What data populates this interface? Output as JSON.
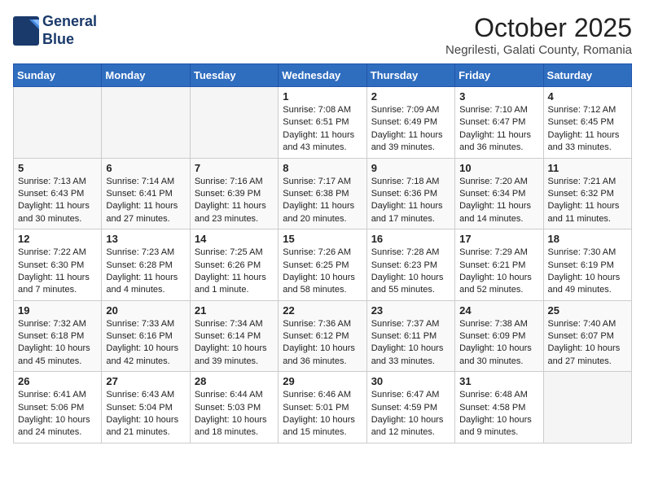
{
  "header": {
    "logo_line1": "General",
    "logo_line2": "Blue",
    "month_title": "October 2025",
    "location": "Negrilesti, Galati County, Romania"
  },
  "days_of_week": [
    "Sunday",
    "Monday",
    "Tuesday",
    "Wednesday",
    "Thursday",
    "Friday",
    "Saturday"
  ],
  "weeks": [
    [
      {
        "day": "",
        "info": ""
      },
      {
        "day": "",
        "info": ""
      },
      {
        "day": "",
        "info": ""
      },
      {
        "day": "1",
        "info": "Sunrise: 7:08 AM\nSunset: 6:51 PM\nDaylight: 11 hours\nand 43 minutes."
      },
      {
        "day": "2",
        "info": "Sunrise: 7:09 AM\nSunset: 6:49 PM\nDaylight: 11 hours\nand 39 minutes."
      },
      {
        "day": "3",
        "info": "Sunrise: 7:10 AM\nSunset: 6:47 PM\nDaylight: 11 hours\nand 36 minutes."
      },
      {
        "day": "4",
        "info": "Sunrise: 7:12 AM\nSunset: 6:45 PM\nDaylight: 11 hours\nand 33 minutes."
      }
    ],
    [
      {
        "day": "5",
        "info": "Sunrise: 7:13 AM\nSunset: 6:43 PM\nDaylight: 11 hours\nand 30 minutes."
      },
      {
        "day": "6",
        "info": "Sunrise: 7:14 AM\nSunset: 6:41 PM\nDaylight: 11 hours\nand 27 minutes."
      },
      {
        "day": "7",
        "info": "Sunrise: 7:16 AM\nSunset: 6:39 PM\nDaylight: 11 hours\nand 23 minutes."
      },
      {
        "day": "8",
        "info": "Sunrise: 7:17 AM\nSunset: 6:38 PM\nDaylight: 11 hours\nand 20 minutes."
      },
      {
        "day": "9",
        "info": "Sunrise: 7:18 AM\nSunset: 6:36 PM\nDaylight: 11 hours\nand 17 minutes."
      },
      {
        "day": "10",
        "info": "Sunrise: 7:20 AM\nSunset: 6:34 PM\nDaylight: 11 hours\nand 14 minutes."
      },
      {
        "day": "11",
        "info": "Sunrise: 7:21 AM\nSunset: 6:32 PM\nDaylight: 11 hours\nand 11 minutes."
      }
    ],
    [
      {
        "day": "12",
        "info": "Sunrise: 7:22 AM\nSunset: 6:30 PM\nDaylight: 11 hours\nand 7 minutes."
      },
      {
        "day": "13",
        "info": "Sunrise: 7:23 AM\nSunset: 6:28 PM\nDaylight: 11 hours\nand 4 minutes."
      },
      {
        "day": "14",
        "info": "Sunrise: 7:25 AM\nSunset: 6:26 PM\nDaylight: 11 hours\nand 1 minute."
      },
      {
        "day": "15",
        "info": "Sunrise: 7:26 AM\nSunset: 6:25 PM\nDaylight: 10 hours\nand 58 minutes."
      },
      {
        "day": "16",
        "info": "Sunrise: 7:28 AM\nSunset: 6:23 PM\nDaylight: 10 hours\nand 55 minutes."
      },
      {
        "day": "17",
        "info": "Sunrise: 7:29 AM\nSunset: 6:21 PM\nDaylight: 10 hours\nand 52 minutes."
      },
      {
        "day": "18",
        "info": "Sunrise: 7:30 AM\nSunset: 6:19 PM\nDaylight: 10 hours\nand 49 minutes."
      }
    ],
    [
      {
        "day": "19",
        "info": "Sunrise: 7:32 AM\nSunset: 6:18 PM\nDaylight: 10 hours\nand 45 minutes."
      },
      {
        "day": "20",
        "info": "Sunrise: 7:33 AM\nSunset: 6:16 PM\nDaylight: 10 hours\nand 42 minutes."
      },
      {
        "day": "21",
        "info": "Sunrise: 7:34 AM\nSunset: 6:14 PM\nDaylight: 10 hours\nand 39 minutes."
      },
      {
        "day": "22",
        "info": "Sunrise: 7:36 AM\nSunset: 6:12 PM\nDaylight: 10 hours\nand 36 minutes."
      },
      {
        "day": "23",
        "info": "Sunrise: 7:37 AM\nSunset: 6:11 PM\nDaylight: 10 hours\nand 33 minutes."
      },
      {
        "day": "24",
        "info": "Sunrise: 7:38 AM\nSunset: 6:09 PM\nDaylight: 10 hours\nand 30 minutes."
      },
      {
        "day": "25",
        "info": "Sunrise: 7:40 AM\nSunset: 6:07 PM\nDaylight: 10 hours\nand 27 minutes."
      }
    ],
    [
      {
        "day": "26",
        "info": "Sunrise: 6:41 AM\nSunset: 5:06 PM\nDaylight: 10 hours\nand 24 minutes."
      },
      {
        "day": "27",
        "info": "Sunrise: 6:43 AM\nSunset: 5:04 PM\nDaylight: 10 hours\nand 21 minutes."
      },
      {
        "day": "28",
        "info": "Sunrise: 6:44 AM\nSunset: 5:03 PM\nDaylight: 10 hours\nand 18 minutes."
      },
      {
        "day": "29",
        "info": "Sunrise: 6:46 AM\nSunset: 5:01 PM\nDaylight: 10 hours\nand 15 minutes."
      },
      {
        "day": "30",
        "info": "Sunrise: 6:47 AM\nSunset: 4:59 PM\nDaylight: 10 hours\nand 12 minutes."
      },
      {
        "day": "31",
        "info": "Sunrise: 6:48 AM\nSunset: 4:58 PM\nDaylight: 10 hours\nand 9 minutes."
      },
      {
        "day": "",
        "info": ""
      }
    ]
  ]
}
